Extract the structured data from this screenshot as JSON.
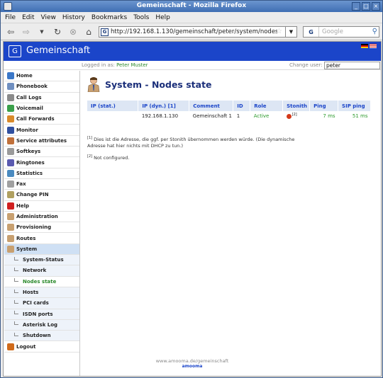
{
  "window": {
    "title": "Gemeinschaft - Mozilla Firefox"
  },
  "menu": [
    "File",
    "Edit",
    "View",
    "History",
    "Bookmarks",
    "Tools",
    "Help"
  ],
  "address": {
    "url": "http://192.168.1.130/gemeinschaft/peter/system/nodesm",
    "favicon": "G"
  },
  "search": {
    "engine": "G",
    "placeholder": "Google"
  },
  "brand": {
    "logo": "[G]",
    "name": "Gemeinschaft"
  },
  "userbar": {
    "logged_label": "Logged in as:",
    "user": "Peter Muster",
    "change_label": "Change user:",
    "change_value": "peter"
  },
  "sidebar": {
    "items": [
      {
        "label": "Home",
        "icon": "home-icon",
        "color": "#3a77c8"
      },
      {
        "label": "Phonebook",
        "icon": "phonebook-icon",
        "color": "#6f8fc0"
      },
      {
        "label": "Call Logs",
        "icon": "call-logs-icon",
        "color": "#8a8a8a"
      },
      {
        "label": "Voicemail",
        "icon": "voicemail-icon",
        "color": "#3aa04a"
      },
      {
        "label": "Call Forwards",
        "icon": "call-forwards-icon",
        "color": "#d98a2a"
      },
      {
        "label": "Monitor",
        "icon": "monitor-icon",
        "color": "#3050a0"
      },
      {
        "label": "Service attributes",
        "icon": "service-attributes-icon",
        "color": "#c0703a"
      },
      {
        "label": "Softkeys",
        "icon": "softkeys-icon",
        "color": "#9a9a9a"
      },
      {
        "label": "Ringtones",
        "icon": "ringtones-icon",
        "color": "#5a5ab0"
      },
      {
        "label": "Statistics",
        "icon": "statistics-icon",
        "color": "#4a8ac0"
      },
      {
        "label": "Fax",
        "icon": "fax-icon",
        "color": "#a0a0a0"
      },
      {
        "label": "Change PIN",
        "icon": "key-icon",
        "color": "#b0a060"
      },
      {
        "label": "Help",
        "icon": "help-icon",
        "color": "#d02020"
      },
      {
        "label": "Administration",
        "icon": "administration-icon",
        "color": "#c8a070"
      },
      {
        "label": "Provisioning",
        "icon": "provisioning-icon",
        "color": "#c8a070"
      },
      {
        "label": "Routes",
        "icon": "routes-icon",
        "color": "#c8a070"
      },
      {
        "label": "System",
        "icon": "system-icon",
        "color": "#c8a070"
      }
    ],
    "subitems": [
      "System-Status",
      "Network",
      "Nodes state",
      "Hosts",
      "PCI cards",
      "ISDN ports",
      "Asterisk Log",
      "Shutdown"
    ],
    "logout": {
      "label": "Logout",
      "icon": "logout-icon",
      "color": "#d06a1a"
    }
  },
  "page": {
    "title": "System - Nodes state"
  },
  "table": {
    "headers": [
      "IP (stat.)",
      "IP (dyn.) [1]",
      "Comment",
      "ID",
      "Role",
      "Stonith",
      "Ping",
      "SIP ping"
    ],
    "rows": [
      {
        "ip_stat": "",
        "ip_dyn": "192.168.1.130",
        "comment": "Gemeinschaft 1",
        "id": "1",
        "role": "Active",
        "stonith": "[2]",
        "ping": "7 ms",
        "sip_ping": "51 ms"
      }
    ]
  },
  "notes": {
    "n1_mark": "[1]",
    "n1": "Dies ist die Adresse, die ggf. per Stonith übernommen werden würde. (Die dynamische Adresse hat hier nichts mit DHCP zu tun.)",
    "n2_mark": "[2]",
    "n2": "Not configured."
  },
  "footer": {
    "link": "www.amooma.de/gemeinschaft",
    "logo": "amooma"
  }
}
